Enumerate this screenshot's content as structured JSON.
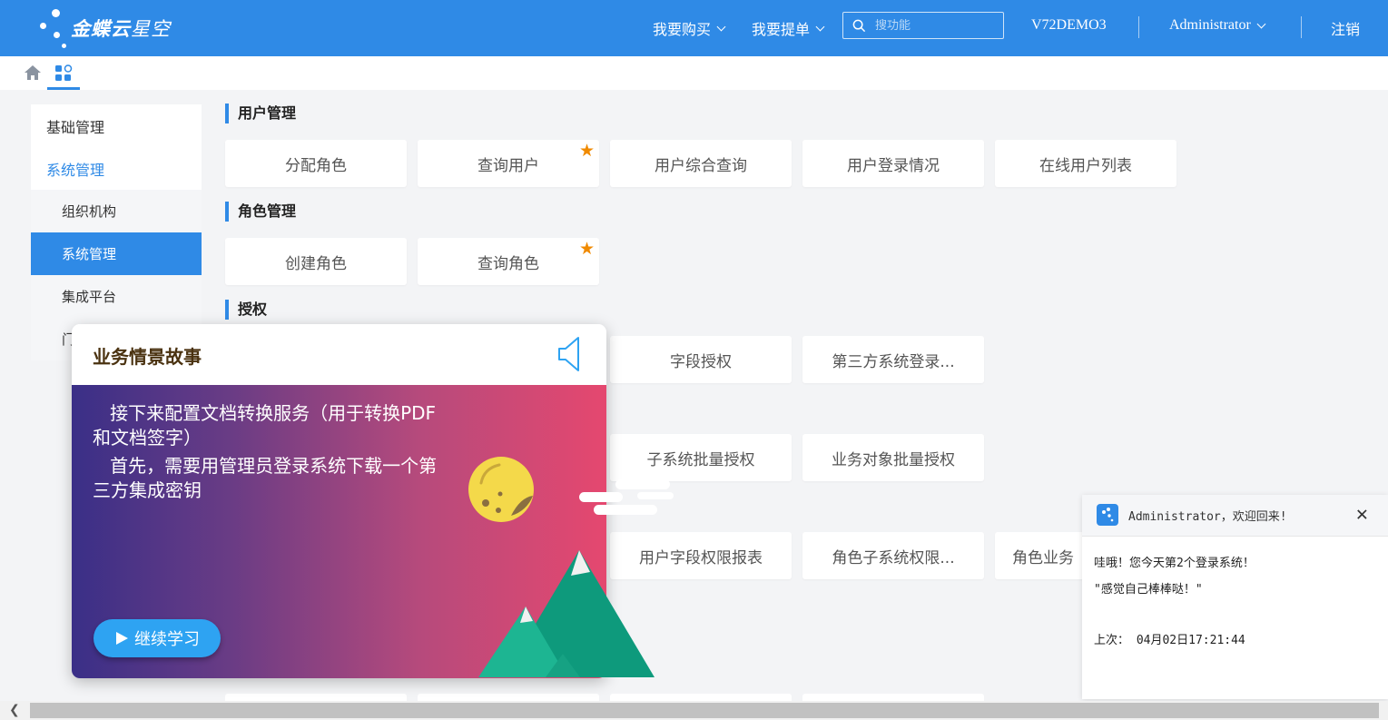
{
  "header": {
    "logo_bold": "金蝶云",
    "logo_light": "星空",
    "nav_buy": "我要购买",
    "nav_ticket": "我要提单",
    "search_placeholder": "搜功能",
    "datacenter": "V72DEMO3",
    "user": "Administrator",
    "logout": "注销",
    "brand_color": "#2f8ae6"
  },
  "sidebar": {
    "items": [
      {
        "label": "基础管理",
        "type": "group"
      },
      {
        "label": "系统管理",
        "type": "group-active"
      },
      {
        "label": "组织机构",
        "type": "sub"
      },
      {
        "label": "系统管理",
        "type": "sub-selected"
      },
      {
        "label": "集成平台",
        "type": "sub"
      },
      {
        "label": "门",
        "type": "sub-partial"
      }
    ]
  },
  "sections": [
    {
      "title": "用户管理",
      "cards": [
        "分配角色",
        "查询用户",
        "用户综合查询",
        "用户登录情况",
        "在线用户列表"
      ],
      "starred": [
        "查询用户"
      ]
    },
    {
      "title": "角色管理",
      "cards": [
        "创建角色",
        "查询角色"
      ],
      "starred": [
        "查询角色"
      ]
    },
    {
      "title": "授权",
      "cards": [
        "字段授权",
        "第三方系统登录..."
      ]
    },
    {
      "title": "",
      "cards": [
        "子系统批量授权",
        "业务对象批量授权"
      ]
    },
    {
      "title": "",
      "cards": [
        "用户字段权限报表",
        "角色子系统权限...",
        "角色业务"
      ]
    }
  ],
  "story": {
    "title": "业务情景故事",
    "line1": "接下来配置文档转换服务（用于转换PDF和文档签字）",
    "line2": "首先，需要用管理员登录系统下载一个第三方集成密钥",
    "button": "继续学习"
  },
  "toast": {
    "title": "Administrator，欢迎回来!",
    "close": "✕",
    "line1": "哇哦！您今天第2个登录系统！",
    "line2": "\"感觉自己棒棒哒！\"",
    "last_login": "上次： 04月02日17:21:44"
  }
}
